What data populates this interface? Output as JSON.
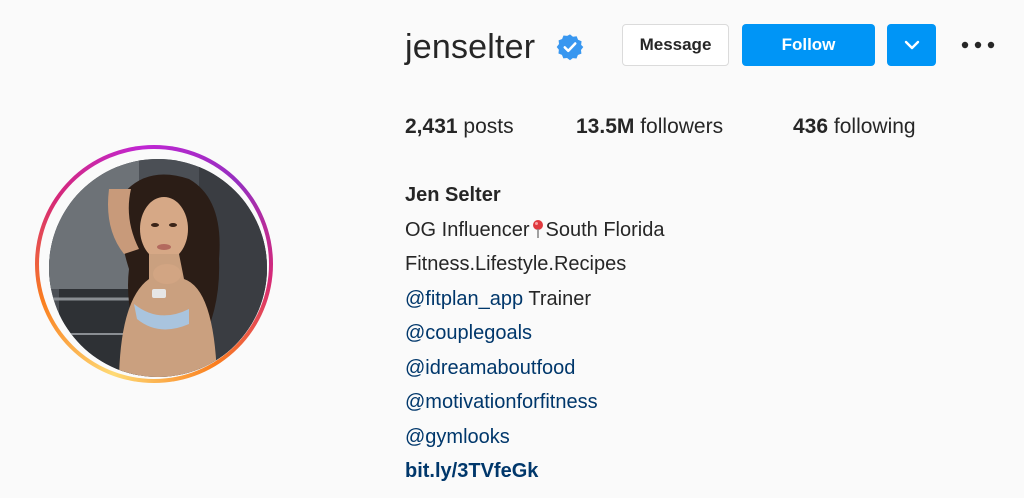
{
  "profile": {
    "username": "jenselter",
    "verified": true,
    "message_label": "Message",
    "follow_label": "Follow",
    "stats": {
      "posts_count": "2,431",
      "posts_label": "posts",
      "followers_count": "13.5M",
      "followers_label": "followers",
      "following_count": "436",
      "following_label": "following"
    },
    "bio": {
      "name": "Jen Selter",
      "line1_pre": "OG Influencer",
      "line1_post": "South Florida",
      "line2": "Fitness.Lifestyle.Recipes",
      "line3_mention": "@fitplan_app",
      "line3_rest": " Trainer",
      "mention2": "@couplegoals",
      "mention3": "@idreamaboutfood",
      "mention4": "@motivationforfitness",
      "mention5": "@gymlooks",
      "link": "bit.ly/3TVfeGk"
    }
  },
  "colors": {
    "accent": "#0095f6",
    "verified_badge": "#3897f0",
    "mention": "#00376b",
    "text": "#262626",
    "background": "#fafafa"
  },
  "icons": {
    "verified": "verified-badge-icon",
    "dropdown": "chevron-down-icon",
    "more": "more-options-icon",
    "pin": "round-pushpin-icon"
  }
}
